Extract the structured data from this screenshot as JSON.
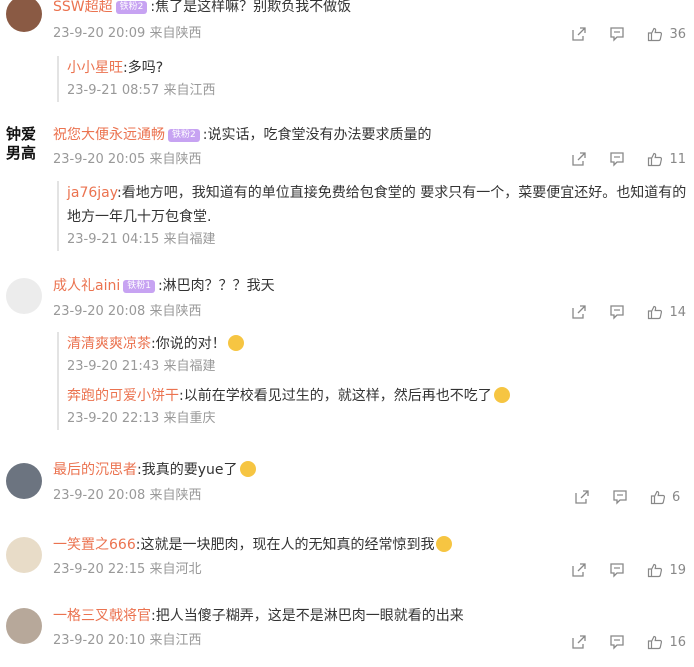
{
  "comments": [
    {
      "name": "SSW超超",
      "badge": "铁粉2",
      "text": ":焦了是这样嘛？别欺负我不做饭",
      "meta": "23-9-20 20:09 来自陕西",
      "likes": "36",
      "replies": [
        {
          "name": "小小星旺",
          "text": ":多吗?",
          "meta": "23-9-21 08:57 来自江西"
        }
      ]
    },
    {
      "name": "祝您大便永远通畅",
      "badge": "铁粉2",
      "text": ":说实话，吃食堂没有办法要求质量的",
      "meta": "23-9-20 20:05 来自陕西",
      "likes": "11",
      "avatar_text": "钟爱男高",
      "replies": [
        {
          "name": "ja76jay",
          "text": ":看地方吧，我知道有的单位直接免费给包食堂的 要求只有一个，菜要便宜还好。也知道有的地方一年几十万包食堂.",
          "meta": "23-9-21 04:15 来自福建"
        }
      ]
    },
    {
      "name": "成人礼aini",
      "badge": "铁粉1",
      "text": ":淋巴肉？？？我天",
      "meta": "23-9-20 20:08 来自陕西",
      "likes": "14",
      "replies": [
        {
          "name": "清清爽爽凉茶",
          "text": ":你说的对！",
          "meta": "23-9-20 21:43 来自福建"
        },
        {
          "name": "奔跑的可爱小饼干",
          "text": ":以前在学校看见过生的，就这样，然后再也不吃了",
          "meta": "23-9-20 22:13 来自重庆"
        }
      ]
    },
    {
      "name": "最后的沉思者",
      "text": ":我真的要yue了",
      "meta": "23-9-20 20:08 来自陕西",
      "likes": "6",
      "replies": []
    },
    {
      "name": "一笑置之666",
      "text": ":这就是一块肥肉，现在人的无知真的经常惊到我",
      "meta": "23-9-20 22:15 来自河北",
      "likes": "19",
      "replies": []
    },
    {
      "name": "一格三叉戟将官",
      "text": ":把人当傻子糊弄，这是不是淋巴肉一眼就看的出来",
      "meta": "23-9-20 20:10 来自江西",
      "likes": "16",
      "replies": []
    }
  ],
  "icons": {
    "share": "share-icon",
    "comment": "comment-icon",
    "like": "thumb-up-icon"
  },
  "colors": {
    "name": "#eb7350",
    "meta": "#999999",
    "badge": "#c7a3f2"
  }
}
